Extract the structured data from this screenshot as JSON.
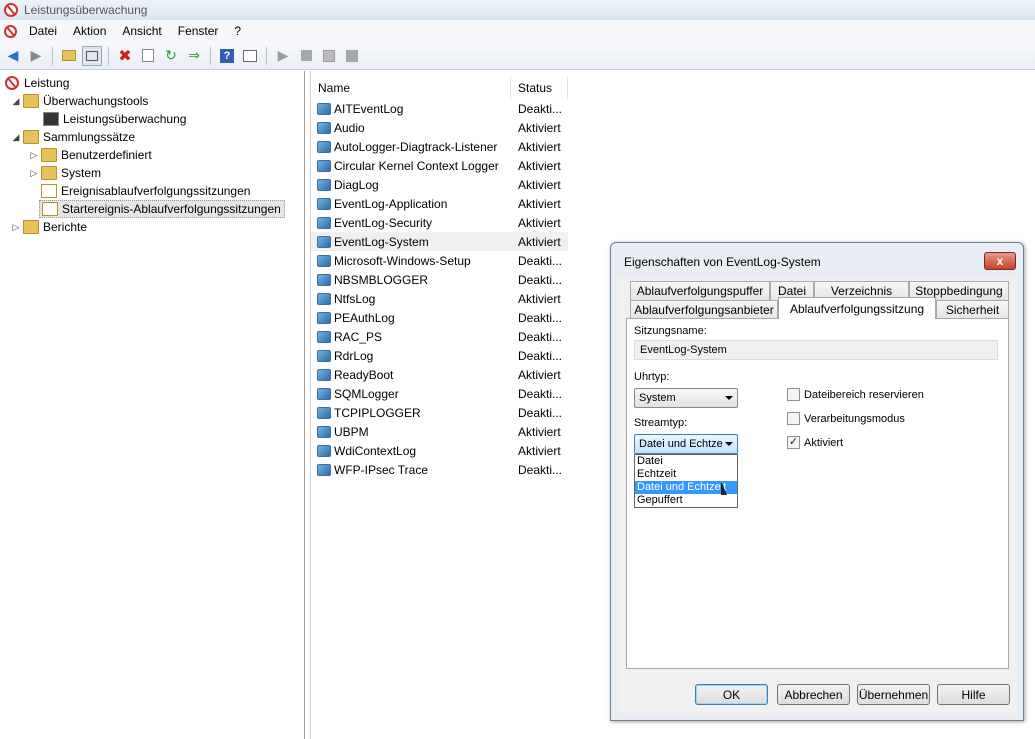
{
  "window": {
    "title": "Leistungsüberwachung"
  },
  "menu": [
    "Datei",
    "Aktion",
    "Ansicht",
    "Fenster",
    "?"
  ],
  "toolbar_icons": [
    "back-icon",
    "forward-icon",
    "open-folder-icon",
    "show-hide-icon",
    "delete-icon",
    "properties-icon",
    "refresh-icon",
    "export-icon",
    "help-icon",
    "panel-icon",
    "start-icon",
    "stop-icon",
    "save-icon",
    "square-icon"
  ],
  "tree": {
    "root": "Leistung",
    "monitoring_tools": "Überwachungstools",
    "perf_monitor": "Leistungsüberwachung",
    "collector_sets": "Sammlungssätze",
    "user_defined": "Benutzerdefiniert",
    "system": "System",
    "event_trace_sessions": "Ereignisablaufverfolgungssitzungen",
    "startup_event_trace_sessions": "Startereignis-Ablaufverfolgungssitzungen",
    "reports": "Berichte"
  },
  "list": {
    "col_name": "Name",
    "col_status": "Status",
    "rows": [
      {
        "name": "AITEventLog",
        "status": "Deakti..."
      },
      {
        "name": "Audio",
        "status": "Aktiviert"
      },
      {
        "name": "AutoLogger-Diagtrack-Listener",
        "status": "Aktiviert"
      },
      {
        "name": "Circular Kernel Context Logger",
        "status": "Aktiviert"
      },
      {
        "name": "DiagLog",
        "status": "Aktiviert"
      },
      {
        "name": "EventLog-Application",
        "status": "Aktiviert"
      },
      {
        "name": "EventLog-Security",
        "status": "Aktiviert"
      },
      {
        "name": "EventLog-System",
        "status": "Aktiviert"
      },
      {
        "name": "Microsoft-Windows-Setup",
        "status": "Deakti..."
      },
      {
        "name": "NBSMBLOGGER",
        "status": "Deakti..."
      },
      {
        "name": "NtfsLog",
        "status": "Aktiviert"
      },
      {
        "name": "PEAuthLog",
        "status": "Deakti..."
      },
      {
        "name": "RAC_PS",
        "status": "Deakti..."
      },
      {
        "name": "RdrLog",
        "status": "Deakti..."
      },
      {
        "name": "ReadyBoot",
        "status": "Aktiviert"
      },
      {
        "name": "SQMLogger",
        "status": "Deakti..."
      },
      {
        "name": "TCPIPLOGGER",
        "status": "Deakti..."
      },
      {
        "name": "UBPM",
        "status": "Aktiviert"
      },
      {
        "name": "WdiContextLog",
        "status": "Aktiviert"
      },
      {
        "name": "WFP-IPsec Trace",
        "status": "Deakti..."
      }
    ]
  },
  "dialog": {
    "title": "Eigenschaften von EventLog-System",
    "close": "x",
    "tabs_row1": [
      "Ablaufverfolgungspuffer",
      "Datei",
      "Verzeichnis",
      "Stoppbedingung"
    ],
    "tabs_row2": [
      "Ablaufverfolgungsanbieter",
      "Ablaufverfolgungssitzung",
      "Sicherheit"
    ],
    "session_name_label": "Sitzungsname:",
    "session_name_value": "EventLog-System",
    "clock_type_label": "Uhrtyp:",
    "clock_type_value": "System",
    "stream_type_label": "Streamtyp:",
    "stream_type_value": "Datei und Echtze",
    "stream_options": [
      "Datei",
      "Echtzeit",
      "Datei und Echtzeit",
      "Gepuffert"
    ],
    "checkboxes": [
      {
        "label": "Dateibereich reservieren",
        "checked": false
      },
      {
        "label": "Verarbeitungsmodus",
        "checked": false
      },
      {
        "label": "Aktiviert",
        "checked": true
      }
    ],
    "buttons": {
      "ok": "OK",
      "cancel": "Abbrechen",
      "apply": "Übernehmen",
      "help": "Hilfe"
    }
  }
}
